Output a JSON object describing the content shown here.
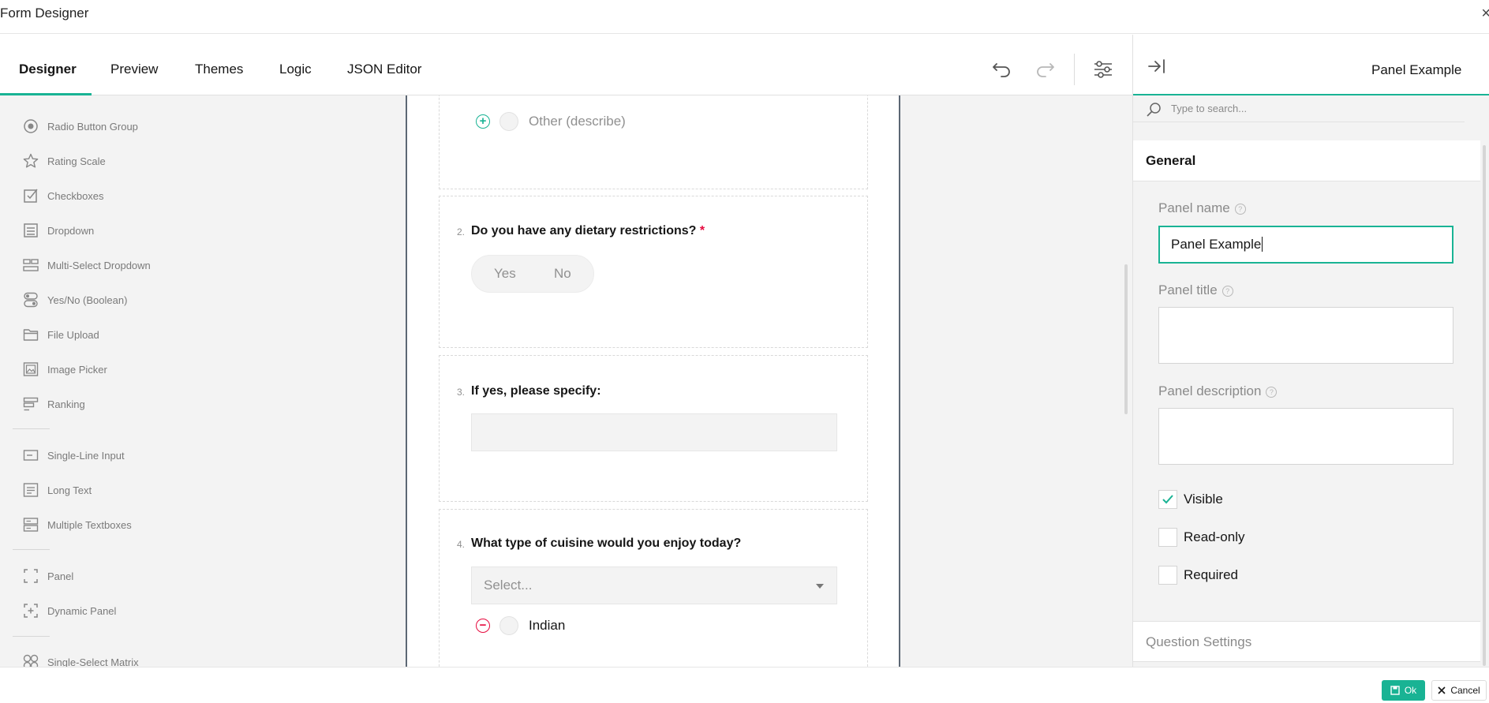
{
  "window": {
    "title": "Form Designer",
    "close_glyph": "×"
  },
  "tabs": [
    {
      "label": "Designer",
      "active": true
    },
    {
      "label": "Preview"
    },
    {
      "label": "Themes"
    },
    {
      "label": "Logic"
    },
    {
      "label": "JSON Editor"
    }
  ],
  "toolbar": {
    "undo_icon": "undo-icon",
    "redo_icon": "redo-icon",
    "settings_icon": "settings-sliders-icon"
  },
  "toolbox": {
    "group1": [
      {
        "label": "Radio Button Group",
        "icon": "radio-icon"
      },
      {
        "label": "Rating Scale",
        "icon": "star-icon"
      },
      {
        "label": "Checkboxes",
        "icon": "checkbox-icon"
      },
      {
        "label": "Dropdown",
        "icon": "dropdown-icon"
      },
      {
        "label": "Multi-Select Dropdown",
        "icon": "tagbox-icon"
      },
      {
        "label": "Yes/No (Boolean)",
        "icon": "boolean-icon"
      },
      {
        "label": "File Upload",
        "icon": "folder-icon"
      },
      {
        "label": "Image Picker",
        "icon": "image-icon"
      },
      {
        "label": "Ranking",
        "icon": "ranking-icon"
      }
    ],
    "group2": [
      {
        "label": "Single-Line Input",
        "icon": "input-icon"
      },
      {
        "label": "Long Text",
        "icon": "text-icon"
      },
      {
        "label": "Multiple Textboxes",
        "icon": "multitext-icon"
      }
    ],
    "group3": [
      {
        "label": "Panel",
        "icon": "panel-icon"
      },
      {
        "label": "Dynamic Panel",
        "icon": "dynamic-panel-icon"
      }
    ],
    "group4": [
      {
        "label": "Single-Select Matrix",
        "icon": "matrix-icon"
      }
    ]
  },
  "survey": {
    "other_option": "Other (describe)",
    "q2": {
      "number": "2.",
      "title": "Do you have any dietary restrictions?",
      "required_mark": "*",
      "yes": "Yes",
      "no": "No"
    },
    "q3": {
      "number": "3.",
      "title": "If yes, please specify:"
    },
    "q4": {
      "number": "4.",
      "title": "What type of cuisine would you enjoy today?",
      "placeholder": "Select...",
      "choice1": "Indian"
    }
  },
  "properties": {
    "header_title": "Panel Example",
    "search_placeholder": "Type to search...",
    "section_general": "General",
    "panel_name_label": "Panel name",
    "panel_name_value": "Panel Example",
    "panel_title_label": "Panel title",
    "panel_description_label": "Panel description",
    "help_glyph": "?",
    "visible_label": "Visible",
    "visible_checked": true,
    "readonly_label": "Read-only",
    "required_label": "Required",
    "section_question_settings": "Question Settings"
  },
  "footer": {
    "ok_label": "Ok",
    "cancel_label": "Cancel"
  },
  "colors": {
    "accent": "#19b394",
    "required": "#e60a3e",
    "panel_bg": "#f3f3f3"
  }
}
